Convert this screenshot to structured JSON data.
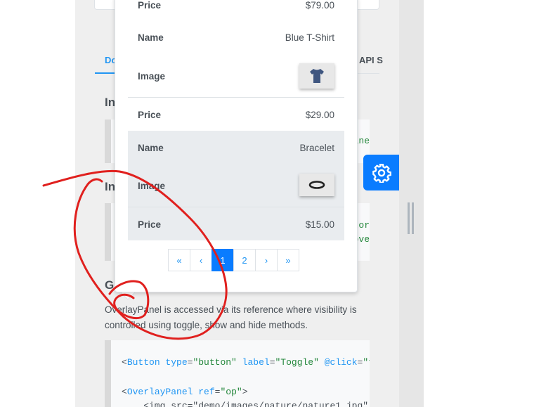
{
  "tabs": {
    "documentation": "Do",
    "api": "API S"
  },
  "headings": {
    "h1": "In",
    "h2": "In",
    "h3": "G"
  },
  "code_tails": {
    "c1": "ane",
    "c2a": "tor",
    "c2b": "ove"
  },
  "description": "OverlayPanel is accessed via its reference where visibility is controlled using toggle, show and hide methods.",
  "code_sample": {
    "line1": {
      "open": "<",
      "tag": "Button",
      "attr1": " type",
      "eq1": "=",
      "val1": "\"button\"",
      "attr2": " label",
      "eq2": "=",
      "val2": "\"Toggle\"",
      "attr3": " @click",
      "eq3": "=",
      "val3": "\"t"
    },
    "line2": {
      "open": "<",
      "tag": "OverlayPanel",
      "attr1": " ref",
      "eq1": "=",
      "val1": "\"op\"",
      "close": ">"
    },
    "line3": {
      "text": "    <img src=\"demo/images/nature/nature1.jpg\""
    }
  },
  "overlay": {
    "rows": [
      {
        "label": "Price",
        "value": "$79.00"
      },
      {
        "label": "Name",
        "value": "Blue T-Shirt"
      },
      {
        "label": "Image",
        "value": ""
      },
      {
        "label": "Price",
        "value": "$29.00"
      },
      {
        "label": "Name",
        "value": "Bracelet"
      },
      {
        "label": "Image",
        "value": ""
      },
      {
        "label": "Price",
        "value": "$15.00"
      }
    ],
    "selected_product": "Bracelet",
    "pagination": {
      "first": "«",
      "prev": "‹",
      "pages": [
        "1",
        "2"
      ],
      "current_page": "1",
      "next": "›",
      "last": "»"
    }
  },
  "icons": {
    "config": "gear-icon",
    "shirt": "t-shirt-thumbnail",
    "bracelet": "bracelet-thumbnail",
    "grip": "drag-handle-icon"
  },
  "colors": {
    "accent": "#0a7cff",
    "link": "#2196f3",
    "annotation": "#e0201e",
    "selected_row": "#e9ecef"
  }
}
